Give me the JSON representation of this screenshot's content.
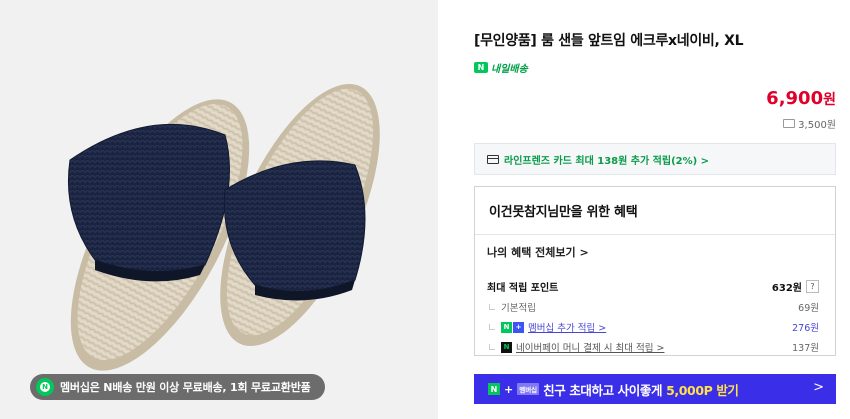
{
  "image": {
    "badge_text": "멤버십은 N배송 만원 이상 무료배송, 1회 무료교환반품"
  },
  "product": {
    "title": "[무인양품] 룸 샌들 앞트임 에크루x네이비, XL",
    "delivery_badge": "N",
    "delivery_label": "내일배송",
    "price": "6,900",
    "price_unit": "원",
    "shipping_fee": "3,500원"
  },
  "card_promo": {
    "text": "라인프렌즈 카드 최대 138원 추가 적립(2%) >"
  },
  "benefits": {
    "heading": "이건못참지님만을 위한 혜택",
    "see_all": "나의 혜택 전체보기 >",
    "max_points_label": "최대 적립 포인트",
    "max_points_value": "632원",
    "help": "?",
    "rows": [
      {
        "label": "기본적립",
        "value": "69원"
      },
      {
        "label": "멤버십 추가 적립 >",
        "value": "276원"
      },
      {
        "label": "네이버페이 머니 결제 시 최대 적립 >",
        "value": "137원"
      }
    ]
  },
  "banner": {
    "n_badge": "N",
    "plus": "+",
    "tag": "멤버십",
    "text": "친구 초대하고 사이좋게",
    "highlight": "5,000P 받기",
    "arrow": ">"
  },
  "colors": {
    "price_red": "#e0002a",
    "naver_green": "#03c75a",
    "banner_purple": "#3a2ee8",
    "highlight_yellow": "#ffe14a"
  }
}
